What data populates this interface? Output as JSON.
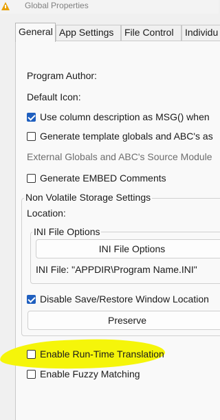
{
  "window": {
    "title": "Global Properties",
    "tabs": [
      {
        "label": "General",
        "active": true
      },
      {
        "label": "App Settings",
        "active": false
      },
      {
        "label": "File Control",
        "active": false
      },
      {
        "label": "Individu",
        "active": false
      }
    ]
  },
  "general": {
    "program_author_label": "Program Author:",
    "default_icon_label": "Default Icon:",
    "use_column_description": {
      "label": "Use column description as MSG() when",
      "checked": true
    },
    "generate_template_globals": {
      "label": "Generate template globals and ABC's as",
      "checked": false
    },
    "external_globals_label": "External Globals and ABC's Source Module",
    "generate_embed_comments": {
      "label": "Generate EMBED Comments",
      "checked": false
    },
    "non_volatile_group": {
      "title": "Non Volatile Storage Settings",
      "location_label": "Location:",
      "ini_group": {
        "title": "INI File Options",
        "button_label": "INI File Options",
        "ini_file_text": "INI File: \"APPDIR\\Program Name.INI\""
      },
      "disable_save_restore": {
        "label": "Disable Save/Restore Window Location",
        "checked": true
      },
      "preserve_button_label": "Preserve"
    },
    "enable_runtime_translation": {
      "label": "Enable Run-Time Translation",
      "checked": false
    },
    "enable_fuzzy_matching": {
      "label": "Enable Fuzzy Matching",
      "checked": false
    }
  },
  "colors": {
    "highlight": "#f5f50a",
    "checkbox_checked": "#1f5fbf"
  }
}
